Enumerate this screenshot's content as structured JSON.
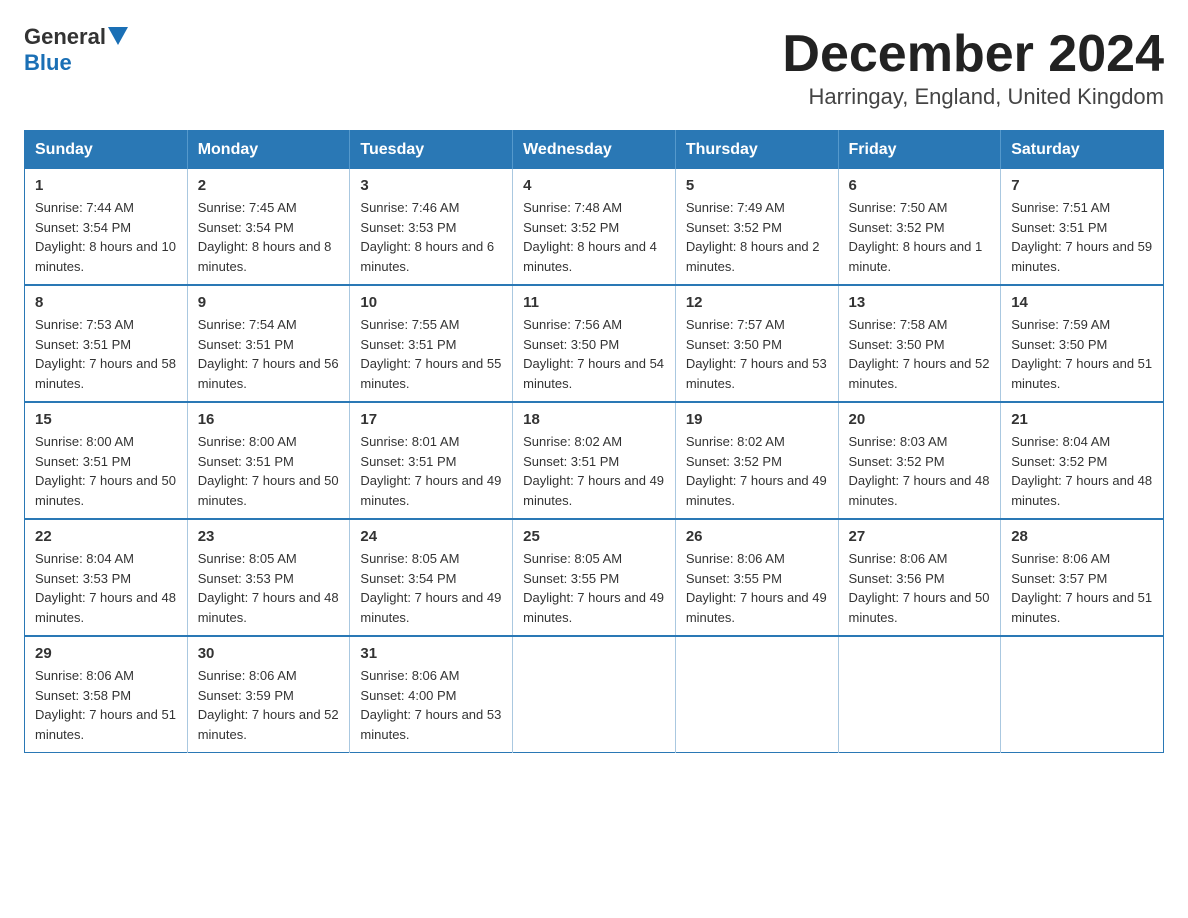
{
  "header": {
    "logo_general": "General",
    "logo_blue": "Blue",
    "month_title": "December 2024",
    "location": "Harringay, England, United Kingdom"
  },
  "days_of_week": [
    "Sunday",
    "Monday",
    "Tuesday",
    "Wednesday",
    "Thursday",
    "Friday",
    "Saturday"
  ],
  "weeks": [
    [
      {
        "day": "1",
        "sunrise": "7:44 AM",
        "sunset": "3:54 PM",
        "daylight": "8 hours and 10 minutes."
      },
      {
        "day": "2",
        "sunrise": "7:45 AM",
        "sunset": "3:54 PM",
        "daylight": "8 hours and 8 minutes."
      },
      {
        "day": "3",
        "sunrise": "7:46 AM",
        "sunset": "3:53 PM",
        "daylight": "8 hours and 6 minutes."
      },
      {
        "day": "4",
        "sunrise": "7:48 AM",
        "sunset": "3:52 PM",
        "daylight": "8 hours and 4 minutes."
      },
      {
        "day": "5",
        "sunrise": "7:49 AM",
        "sunset": "3:52 PM",
        "daylight": "8 hours and 2 minutes."
      },
      {
        "day": "6",
        "sunrise": "7:50 AM",
        "sunset": "3:52 PM",
        "daylight": "8 hours and 1 minute."
      },
      {
        "day": "7",
        "sunrise": "7:51 AM",
        "sunset": "3:51 PM",
        "daylight": "7 hours and 59 minutes."
      }
    ],
    [
      {
        "day": "8",
        "sunrise": "7:53 AM",
        "sunset": "3:51 PM",
        "daylight": "7 hours and 58 minutes."
      },
      {
        "day": "9",
        "sunrise": "7:54 AM",
        "sunset": "3:51 PM",
        "daylight": "7 hours and 56 minutes."
      },
      {
        "day": "10",
        "sunrise": "7:55 AM",
        "sunset": "3:51 PM",
        "daylight": "7 hours and 55 minutes."
      },
      {
        "day": "11",
        "sunrise": "7:56 AM",
        "sunset": "3:50 PM",
        "daylight": "7 hours and 54 minutes."
      },
      {
        "day": "12",
        "sunrise": "7:57 AM",
        "sunset": "3:50 PM",
        "daylight": "7 hours and 53 minutes."
      },
      {
        "day": "13",
        "sunrise": "7:58 AM",
        "sunset": "3:50 PM",
        "daylight": "7 hours and 52 minutes."
      },
      {
        "day": "14",
        "sunrise": "7:59 AM",
        "sunset": "3:50 PM",
        "daylight": "7 hours and 51 minutes."
      }
    ],
    [
      {
        "day": "15",
        "sunrise": "8:00 AM",
        "sunset": "3:51 PM",
        "daylight": "7 hours and 50 minutes."
      },
      {
        "day": "16",
        "sunrise": "8:00 AM",
        "sunset": "3:51 PM",
        "daylight": "7 hours and 50 minutes."
      },
      {
        "day": "17",
        "sunrise": "8:01 AM",
        "sunset": "3:51 PM",
        "daylight": "7 hours and 49 minutes."
      },
      {
        "day": "18",
        "sunrise": "8:02 AM",
        "sunset": "3:51 PM",
        "daylight": "7 hours and 49 minutes."
      },
      {
        "day": "19",
        "sunrise": "8:02 AM",
        "sunset": "3:52 PM",
        "daylight": "7 hours and 49 minutes."
      },
      {
        "day": "20",
        "sunrise": "8:03 AM",
        "sunset": "3:52 PM",
        "daylight": "7 hours and 48 minutes."
      },
      {
        "day": "21",
        "sunrise": "8:04 AM",
        "sunset": "3:52 PM",
        "daylight": "7 hours and 48 minutes."
      }
    ],
    [
      {
        "day": "22",
        "sunrise": "8:04 AM",
        "sunset": "3:53 PM",
        "daylight": "7 hours and 48 minutes."
      },
      {
        "day": "23",
        "sunrise": "8:05 AM",
        "sunset": "3:53 PM",
        "daylight": "7 hours and 48 minutes."
      },
      {
        "day": "24",
        "sunrise": "8:05 AM",
        "sunset": "3:54 PM",
        "daylight": "7 hours and 49 minutes."
      },
      {
        "day": "25",
        "sunrise": "8:05 AM",
        "sunset": "3:55 PM",
        "daylight": "7 hours and 49 minutes."
      },
      {
        "day": "26",
        "sunrise": "8:06 AM",
        "sunset": "3:55 PM",
        "daylight": "7 hours and 49 minutes."
      },
      {
        "day": "27",
        "sunrise": "8:06 AM",
        "sunset": "3:56 PM",
        "daylight": "7 hours and 50 minutes."
      },
      {
        "day": "28",
        "sunrise": "8:06 AM",
        "sunset": "3:57 PM",
        "daylight": "7 hours and 51 minutes."
      }
    ],
    [
      {
        "day": "29",
        "sunrise": "8:06 AM",
        "sunset": "3:58 PM",
        "daylight": "7 hours and 51 minutes."
      },
      {
        "day": "30",
        "sunrise": "8:06 AM",
        "sunset": "3:59 PM",
        "daylight": "7 hours and 52 minutes."
      },
      {
        "day": "31",
        "sunrise": "8:06 AM",
        "sunset": "4:00 PM",
        "daylight": "7 hours and 53 minutes."
      },
      null,
      null,
      null,
      null
    ]
  ]
}
